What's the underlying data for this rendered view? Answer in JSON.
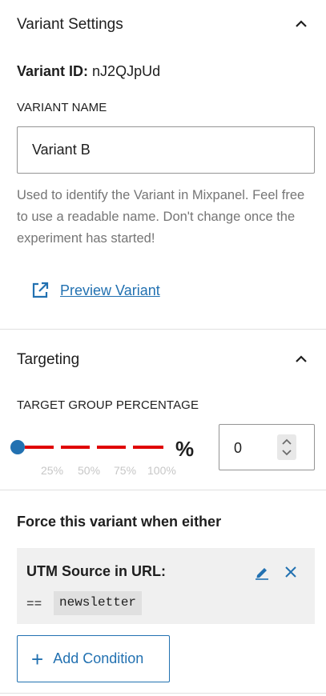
{
  "variant_settings": {
    "title": "Variant Settings",
    "variant_id_label": "Variant ID:",
    "variant_id_value": "nJ2QJpUd",
    "name_label": "VARIANT NAME",
    "name_value": "Variant B",
    "help_text": "Used to identify the Variant in Mixpanel. Feel free to use a readable name. Don't change once the experiment has started!",
    "preview_link": "Preview Variant"
  },
  "targeting": {
    "title": "Targeting",
    "percentage_label": "TARGET GROUP PERCENTAGE",
    "slider_value": 0,
    "tick_labels": [
      "25%",
      "50%",
      "75%",
      "100%"
    ],
    "percent_sign": "%",
    "number_value": "0"
  },
  "force": {
    "title": "Force this variant when either",
    "conditions": [
      {
        "title": "UTM Source in URL:",
        "operator": "==",
        "value": "newsletter"
      }
    ],
    "add_condition_label": "Add Condition"
  },
  "colors": {
    "accent": "#2271b1",
    "slider_track": "#e00000",
    "slider_thumb": "#2271b1"
  },
  "icons": {
    "collapse": "chevron-up-icon",
    "external": "external-link-icon",
    "edit": "pencil-icon",
    "remove": "close-icon",
    "add": "plus-icon",
    "spinner": "spinner-arrows-icon"
  }
}
